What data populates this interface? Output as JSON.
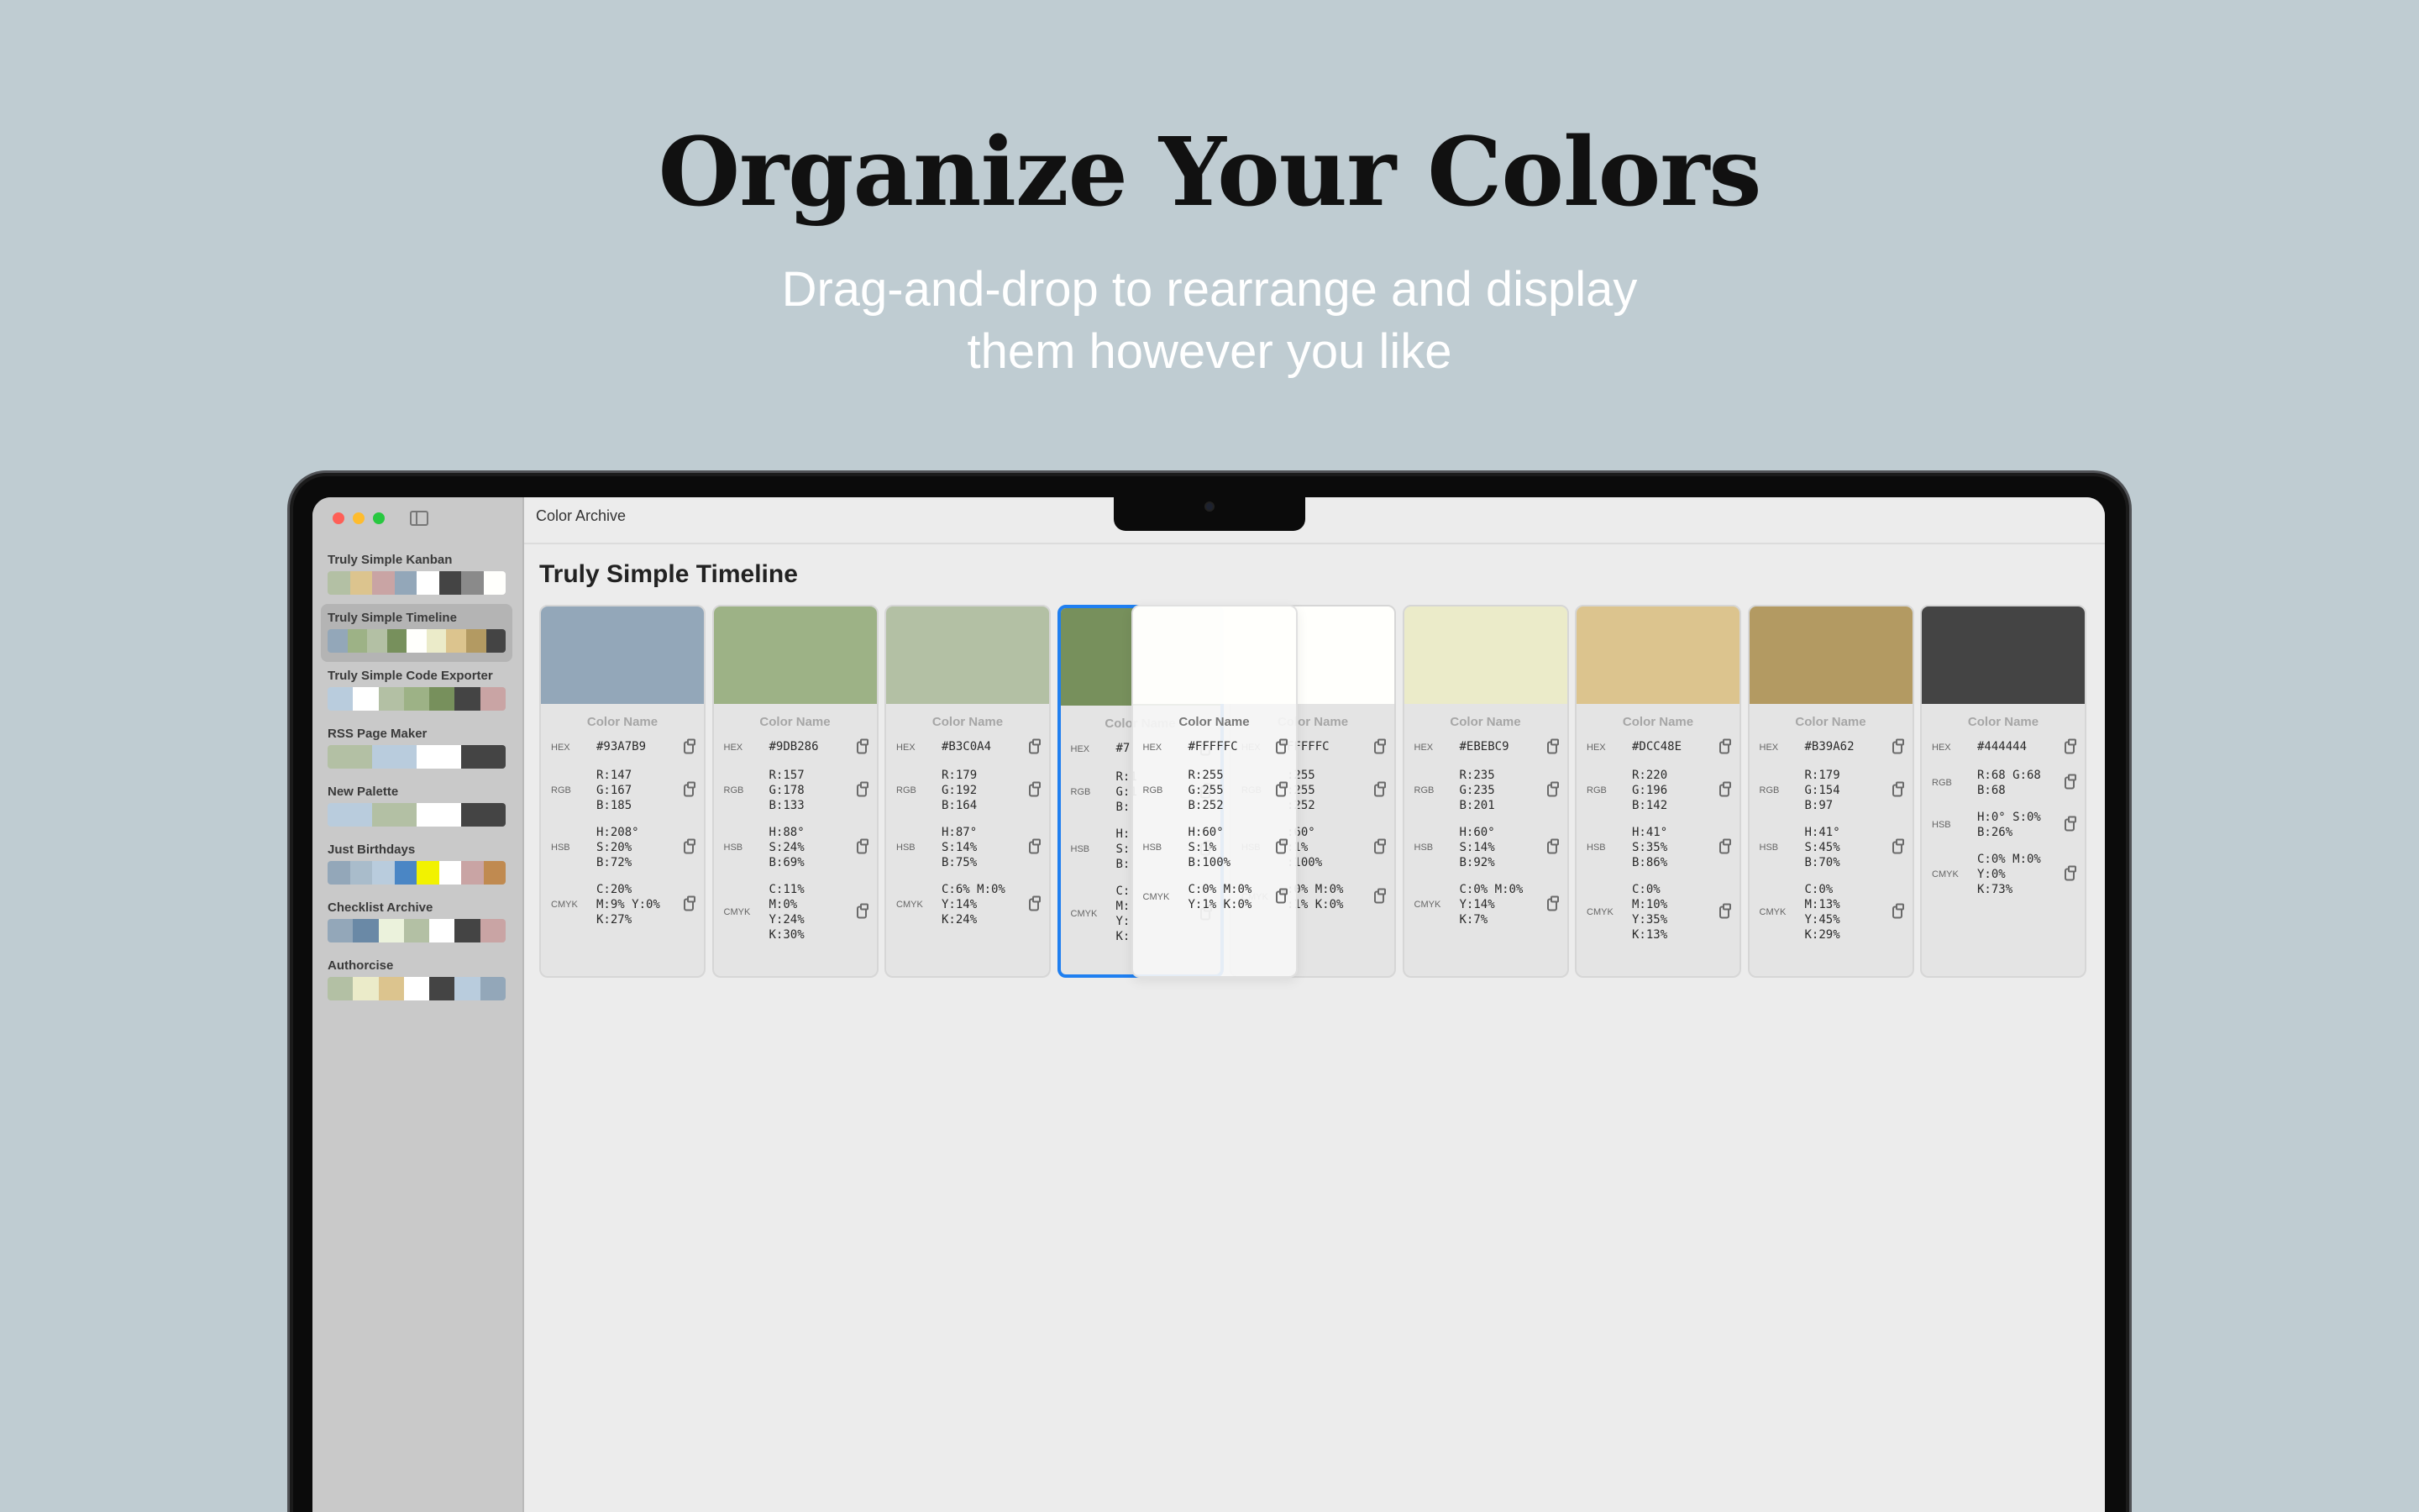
{
  "hero": {
    "headline": "Organize Your Colors",
    "subline_1": "Drag-and-drop to rearrange and display",
    "subline_2": "them however you like"
  },
  "window": {
    "app_title": "Color Archive",
    "palette_title": "Truly Simple Timeline"
  },
  "sidebar": {
    "items": [
      {
        "name": "Truly Simple Kanban",
        "selected": false,
        "colors": [
          "#B3C0A4",
          "#DCC48E",
          "#C9A4A4",
          "#93A7B9",
          "#FFFFFF",
          "#444444",
          "#8A8A8A",
          "#FFFFFC"
        ]
      },
      {
        "name": "Truly Simple Timeline",
        "selected": true,
        "colors": [
          "#93A7B9",
          "#9DB286",
          "#B3C0A4",
          "#77905C",
          "#FFFFFC",
          "#EBEBC9",
          "#DCC48E",
          "#B39A62",
          "#444444"
        ]
      },
      {
        "name": "Truly Simple Code Exporter",
        "selected": false,
        "colors": [
          "#B9CCDD",
          "#FFFFFF",
          "#B3C0A4",
          "#9DB286",
          "#77905C",
          "#444444",
          "#C9A4A4"
        ]
      },
      {
        "name": "RSS Page Maker",
        "selected": false,
        "colors": [
          "#B3C0A4",
          "#B9CCDD",
          "#FFFFFF",
          "#444444"
        ]
      },
      {
        "name": "New Palette",
        "selected": false,
        "colors": [
          "#B9CCDD",
          "#B3C0A4",
          "#FFFFFF",
          "#444444"
        ]
      },
      {
        "name": "Just Birthdays",
        "selected": false,
        "colors": [
          "#93A7B9",
          "#A9BCCB",
          "#B9CCDD",
          "#4A86C5",
          "#F2F200",
          "#FFFFFF",
          "#C9A4A4",
          "#C08A50"
        ]
      },
      {
        "name": "Checklist Archive",
        "selected": false,
        "colors": [
          "#93A7B9",
          "#6A89A6",
          "#EBF2DC",
          "#B3C0A4",
          "#FFFFFF",
          "#444444",
          "#C9A4A4"
        ]
      },
      {
        "name": "Authorcise",
        "selected": false,
        "colors": [
          "#B3C0A4",
          "#EBEBC9",
          "#DCC48E",
          "#FFFFFF",
          "#444444",
          "#B9CCDD",
          "#93A7B9"
        ]
      }
    ]
  },
  "labels": {
    "color_name": "Color Name",
    "hex": "HEX",
    "rgb": "RGB",
    "hsb": "HSB",
    "cmyk": "CMYK"
  },
  "cards": [
    {
      "swatch": "#93A7B9",
      "hex": "#93A7B9",
      "rgb": "R:147\nG:167\nB:185",
      "hsb": "H:208°\nS:20%\nB:72%",
      "cmyk": "C:20%\nM:9% Y:0%\nK:27%"
    },
    {
      "swatch": "#9DB286",
      "hex": "#9DB286",
      "rgb": "R:157\nG:178\nB:133",
      "hsb": "H:88°\nS:24%\nB:69%",
      "cmyk": "C:11%\nM:0%\nY:24%\nK:30%"
    },
    {
      "swatch": "#B3C0A4",
      "hex": "#B3C0A4",
      "rgb": "R:179\nG:192\nB:164",
      "hsb": "H:87°\nS:14%\nB:75%",
      "cmyk": "C:6% M:0%\nY:14%\nK:24%"
    },
    {
      "swatch": "#77905C",
      "hex": "#7",
      "rgb": "R:1\nG:1\nB:",
      "hsb": "H:\nS:\nB:",
      "cmyk": "C:\nM:\nY:\nK:"
    },
    {
      "swatch": "#FFFFFC",
      "hex": "FFFFFC",
      "rgb": ":255\n:255\n:252",
      "hsb": ":60°\n:1%\n:100%",
      "cmyk": ":0% M:0%\n:1% K:0%"
    },
    {
      "swatch": "#EBEBC9",
      "hex": "#EBEBC9",
      "rgb": "R:235\nG:235\nB:201",
      "hsb": "H:60°\nS:14%\nB:92%",
      "cmyk": "C:0% M:0%\nY:14%\nK:7%"
    },
    {
      "swatch": "#DCC48E",
      "hex": "#DCC48E",
      "rgb": "R:220\nG:196\nB:142",
      "hsb": "H:41°\nS:35%\nB:86%",
      "cmyk": "C:0%\nM:10%\nY:35%\nK:13%"
    },
    {
      "swatch": "#B39A62",
      "hex": "#B39A62",
      "rgb": "R:179\nG:154\nB:97",
      "hsb": "H:41°\nS:45%\nB:70%",
      "cmyk": "C:0%\nM:13%\nY:45%\nK:29%"
    },
    {
      "swatch": "#444444",
      "hex": "#444444",
      "rgb": "R:68 G:68\nB:68",
      "hsb": "H:0° S:0%\nB:26%",
      "cmyk": "C:0% M:0%\nY:0%\nK:73%"
    }
  ],
  "dragged": {
    "swatch": "#FFFFFC",
    "hex": "#FFFFFC",
    "rgb": "R:255\nG:255\nB:252",
    "hsb": "H:60°\nS:1%\nB:100%",
    "cmyk": "C:0% M:0%\nY:1% K:0%"
  }
}
